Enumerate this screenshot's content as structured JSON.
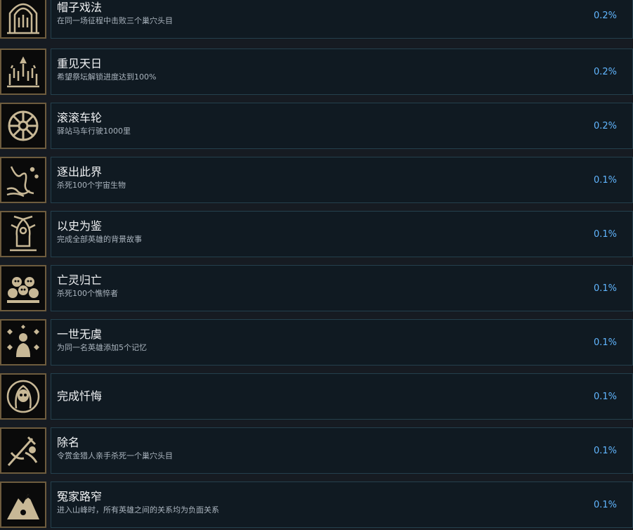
{
  "achievements": [
    {
      "title": "帽子戏法",
      "description": "在同一场征程中击败三个巢穴头目",
      "percent": "0.2%",
      "icon": "gothic-arch-icon"
    },
    {
      "title": "重见天日",
      "description": "希望祭坛解锁进度达到100%",
      "percent": "0.2%",
      "icon": "candles-altar-icon"
    },
    {
      "title": "滚滚车轮",
      "description": "驿站马车行驶1000里",
      "percent": "0.2%",
      "icon": "wagon-wheel-icon"
    },
    {
      "title": "逐出此界",
      "description": "杀死100个宇宙生物",
      "percent": "0.1%",
      "icon": "cosmic-tentacle-icon"
    },
    {
      "title": "以史为鉴",
      "description": "完成全部英雄的背景故事",
      "percent": "0.1%",
      "icon": "hero-shrine-icon"
    },
    {
      "title": "亡灵归亡",
      "description": "杀死100个憔悴者",
      "percent": "0.1%",
      "icon": "skull-pile-icon"
    },
    {
      "title": "一世无虞",
      "description": "为同一名英雄添加5个记忆",
      "percent": "0.1%",
      "icon": "hero-memories-icon"
    },
    {
      "title": "完成忏悔",
      "description": "",
      "percent": "0.1%",
      "icon": "hooded-skull-icon"
    },
    {
      "title": "除名",
      "description": "令赏金猎人亲手杀死一个巢穴头目",
      "percent": "0.1%",
      "icon": "bounty-hunter-icon"
    },
    {
      "title": "冤家路窄",
      "description": "进入山峰时，所有英雄之间的关系均为负面关系",
      "percent": "0.1%",
      "icon": "mountain-peak-icon"
    }
  ],
  "colors": {
    "background": "#161b22",
    "panel": "#101a22",
    "panel_border": "#24404d",
    "percent": "#61b6ff",
    "icon_tan": "#c8b896",
    "icon_frame": "#6e5c3e"
  }
}
